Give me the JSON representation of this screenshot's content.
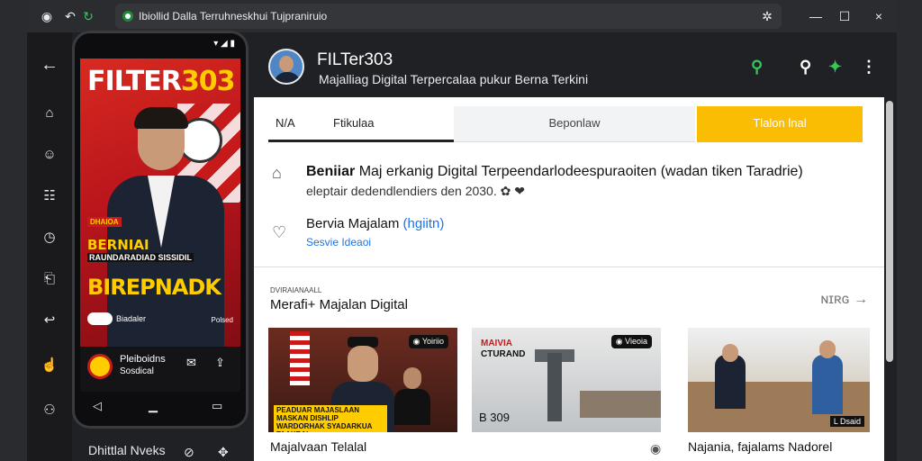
{
  "browser": {
    "tab_title": "Ibiollid Dalla Terruhneskhui Tujpraniruio",
    "close_tab": "×"
  },
  "phone": {
    "status": "▾ ◢ ▮",
    "poster_title_a": "FILTER",
    "poster_title_b": "303",
    "poster_badge": "DHAIOA",
    "poster_line1": "BERNIAI",
    "poster_line2": "RAUNDARADIAD SISSIDIL",
    "poster_line3": "BIREPNADK",
    "poster_line4": "Biadaler",
    "poster_line5": "Polsed",
    "bar_title": "Pleiboidns",
    "bar_sub": "Sosdical"
  },
  "below_phone_text": "Dhittlal Nveks",
  "app": {
    "title": "FILTer303",
    "subtitle": "Majalliag Digital Terpercalaa pukur Berna Terkini"
  },
  "tabs": {
    "a1": "N/A",
    "a2": "Ftikulaa",
    "b": "Beponlaw",
    "c": "Tlalon lnal"
  },
  "info": {
    "line1_bold": "Beniiar",
    "line1_rest": " Maj erkanig Digital Terpeendarlodeespuraoiten (wadan tiken Taradrie)",
    "line2": "eleptair dedendlendiers den 2030. ✿ ❤",
    "line3_a": "Bervia Majalam ",
    "line3_b": "(hgiitn)",
    "line4": "Sesvie Ideaoi"
  },
  "section": {
    "overline": "DVIRAIANAALL",
    "title": "Merafi+ Majalan Digital",
    "more": "ɴɪʀɢ →"
  },
  "cards": [
    {
      "badge": "◉ Yoiriio",
      "caption_img": "PEADUAR MAJASLAAN MASKAN DISHLIP WARDORHAK SYADARKUA TAAKRAI",
      "caption": "Majalvaan Telalal"
    },
    {
      "badge": "◉ Vieoia",
      "tag1": "MAIVIA",
      "tag2": "CTURAND",
      "bottom": "B 309",
      "caption": ""
    },
    {
      "badge": "",
      "bottom": "L Dsaid",
      "caption": "Najania, fajalams Nadorel"
    }
  ],
  "colors": {
    "accent_yellow": "#fbbc04",
    "brand_red": "#c81a1a",
    "icon_green": "#34c759",
    "link_blue": "#1a73e8"
  }
}
